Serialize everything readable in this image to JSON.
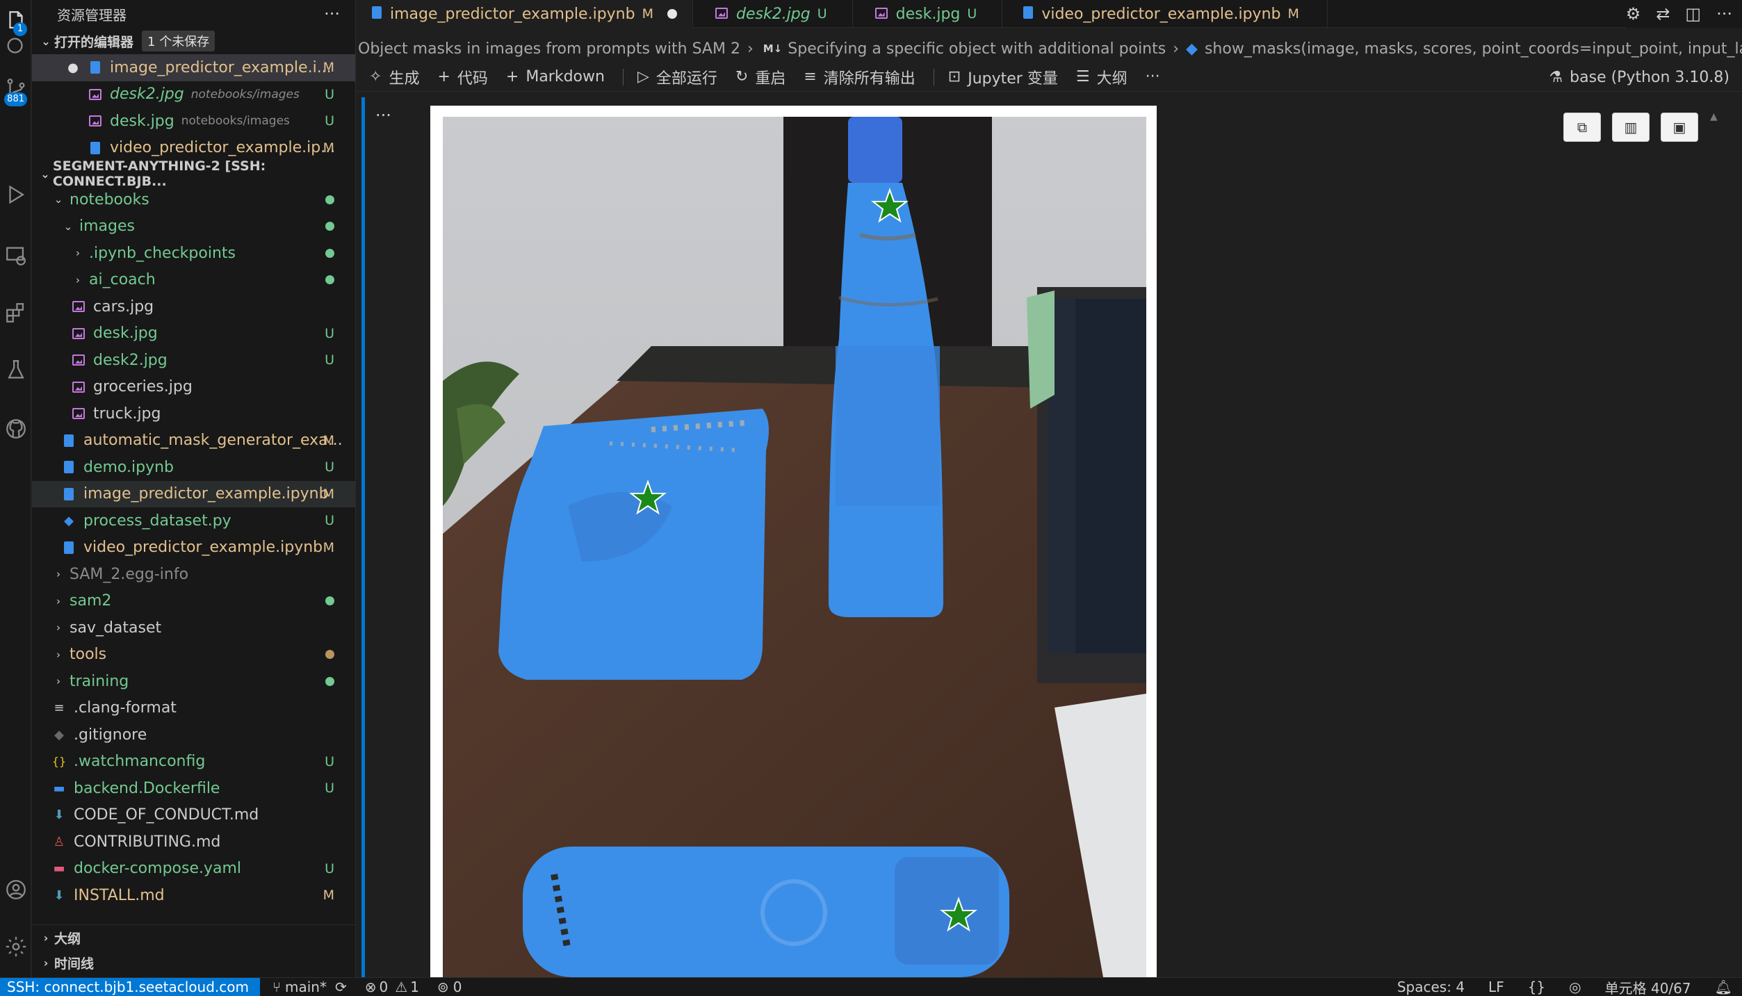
{
  "activity_bar": {
    "explorer_badge": "1",
    "scm_badge": "881"
  },
  "sidebar": {
    "title": "资源管理器",
    "more": "···",
    "open_editors": {
      "label": "打开的编辑器",
      "unsaved_tag": "1 个未保存",
      "items": [
        {
          "name": "image_predictor_example.i...",
          "hint": "",
          "status": "M"
        },
        {
          "name": "desk2.jpg",
          "hint": "notebooks/images",
          "status": "U"
        },
        {
          "name": "desk.jpg",
          "hint": "notebooks/images",
          "status": "U"
        },
        {
          "name": "video_predictor_example.ip...",
          "hint": "",
          "status": "M"
        }
      ]
    },
    "workspace": {
      "label": "SEGMENT-ANYTHING-2 [SSH: CONNECT.BJB...",
      "items": [
        {
          "name": "notebooks",
          "status": ""
        },
        {
          "name": "images",
          "status": ""
        },
        {
          "name": ".ipynb_checkpoints",
          "status": ""
        },
        {
          "name": "ai_coach",
          "status": ""
        },
        {
          "name": "cars.jpg",
          "status": ""
        },
        {
          "name": "desk.jpg",
          "status": "U"
        },
        {
          "name": "desk2.jpg",
          "status": "U"
        },
        {
          "name": "groceries.jpg",
          "status": ""
        },
        {
          "name": "truck.jpg",
          "status": ""
        },
        {
          "name": "automatic_mask_generator_exa...",
          "status": "M"
        },
        {
          "name": "demo.ipynb",
          "status": "U"
        },
        {
          "name": "image_predictor_example.ipynb",
          "status": "M"
        },
        {
          "name": "process_dataset.py",
          "status": "U"
        },
        {
          "name": "video_predictor_example.ipynb",
          "status": "M"
        },
        {
          "name": "SAM_2.egg-info",
          "status": ""
        },
        {
          "name": "sam2",
          "status": ""
        },
        {
          "name": "sav_dataset",
          "status": ""
        },
        {
          "name": "tools",
          "status": ""
        },
        {
          "name": "training",
          "status": ""
        },
        {
          "name": ".clang-format",
          "status": ""
        },
        {
          "name": ".gitignore",
          "status": ""
        },
        {
          "name": ".watchmanconfig",
          "status": "U"
        },
        {
          "name": "backend.Dockerfile",
          "status": "U"
        },
        {
          "name": "CODE_OF_CONDUCT.md",
          "status": ""
        },
        {
          "name": "CONTRIBUTING.md",
          "status": ""
        },
        {
          "name": "docker-compose.yaml",
          "status": "U"
        },
        {
          "name": "INSTALL.md",
          "status": "M"
        }
      ]
    },
    "outline_label": "大纲",
    "timeline_label": "时间线"
  },
  "tabs": [
    {
      "label": "image_predictor_example.ipynb",
      "status": "M"
    },
    {
      "label": "desk2.jpg",
      "status": "U"
    },
    {
      "label": "desk.jpg",
      "status": "U"
    },
    {
      "label": "video_predictor_example.ipynb",
      "status": "M"
    }
  ],
  "breadcrumb": {
    "part1": "Object masks in images from prompts with SAM 2",
    "md_badge": "M↓",
    "part2": "Specifying a specific object with additional points",
    "part3": "show_masks(image, masks, scores, point_coords=input_point, input_labels=input_labe"
  },
  "toolbar": {
    "generate": "生成",
    "code": "代码",
    "markdown": "Markdown",
    "run_all": "全部运行",
    "restart": "重启",
    "clear_outputs": "清除所有输出",
    "variables": "Jupyter 变量",
    "outline": "大纲",
    "more": "···",
    "kernel": "base (Python 3.10.8)"
  },
  "cell": {
    "more": "···"
  },
  "status_bar": {
    "remote": "SSH: connect.bjb1.seetacloud.com",
    "branch": "main*",
    "errors": "0",
    "warnings": "1",
    "ports": "0",
    "spaces": "Spaces: 4",
    "eol": "LF",
    "braces": "{}",
    "cell_position": "单元格 40/67"
  },
  "colors": {
    "accent": "#0078d4",
    "modified": "#e2c08d",
    "untracked": "#73c991",
    "mask": "#3c8fe8",
    "star": "#1a8a1a"
  }
}
